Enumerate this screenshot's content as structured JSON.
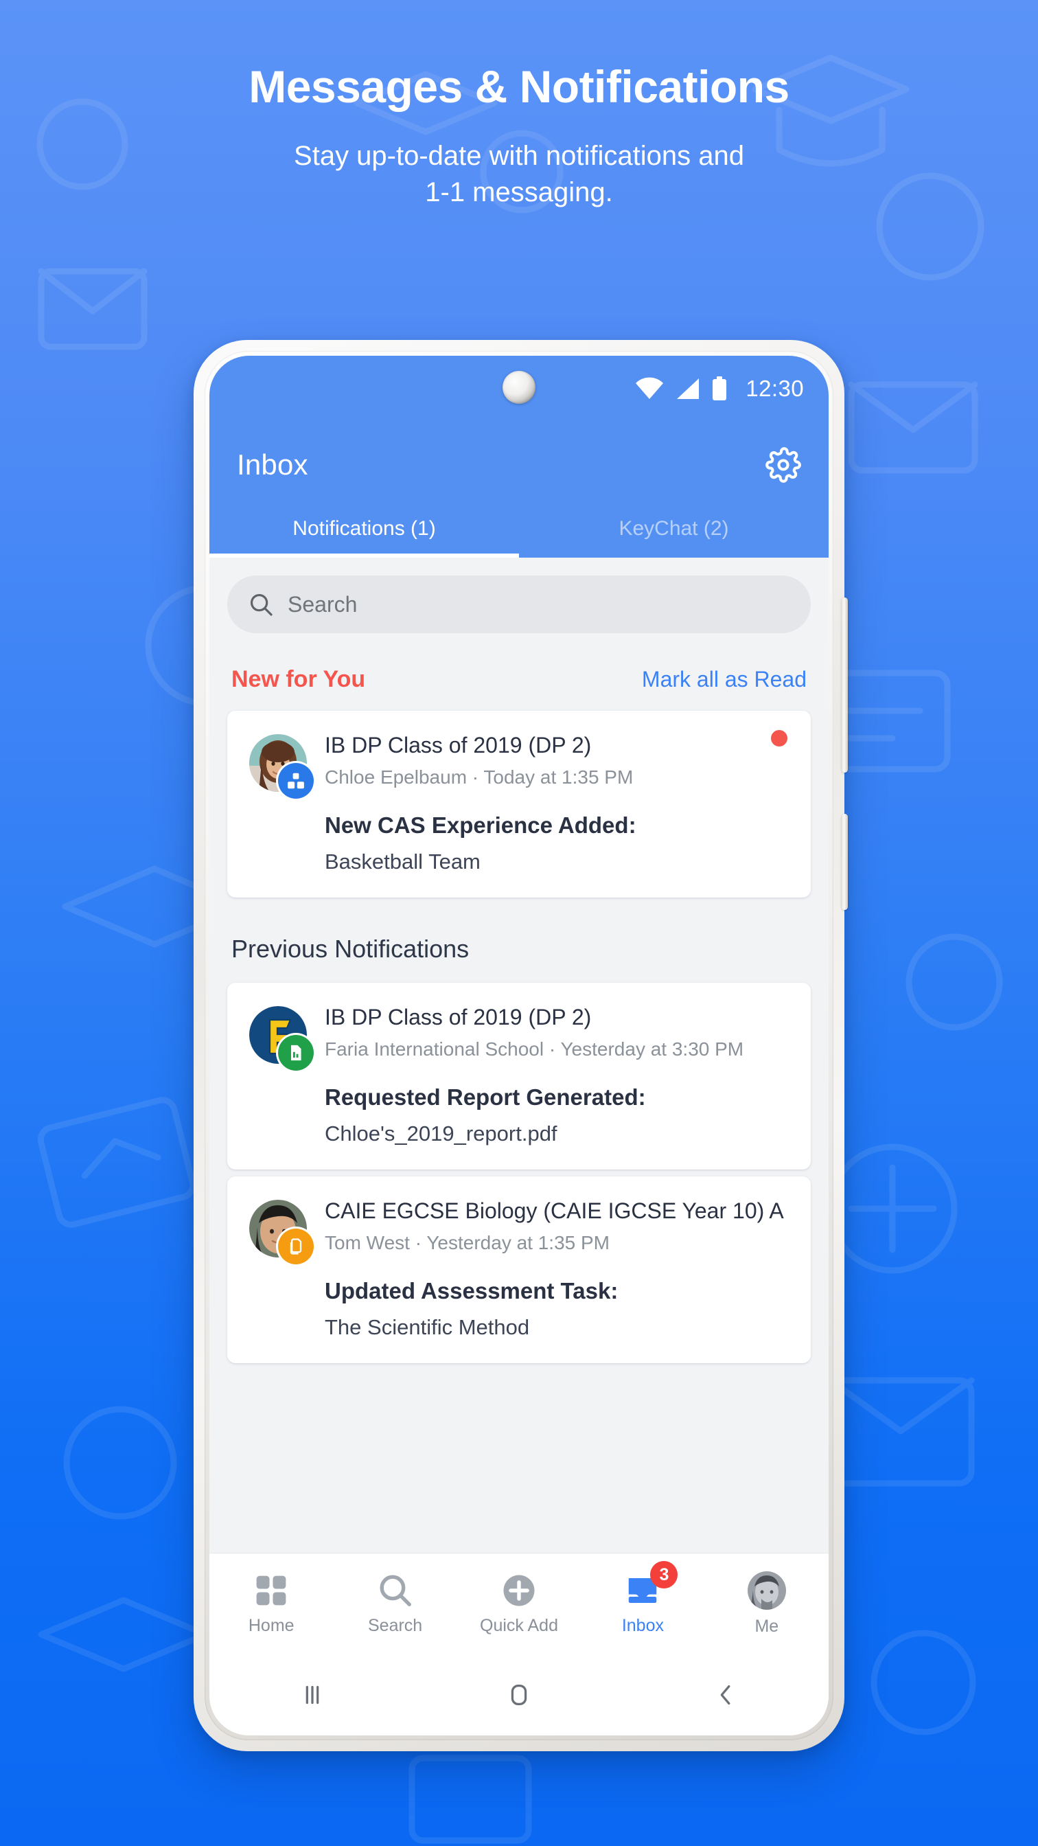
{
  "promo": {
    "title": "Messages & Notifications",
    "subtitle_line1": "Stay up-to-date with notifications and",
    "subtitle_line2": "1-1 messaging."
  },
  "colors": {
    "bg_top": "#5b93f7",
    "bg_bottom": "#0b68f2",
    "app_blue": "#5490f2",
    "accent_blue": "#3b82f6",
    "accent_red": "#f4564e",
    "badge_red": "#f4403b",
    "screen_bg": "#f1f3f5"
  },
  "status_bar": {
    "time": "12:30",
    "icons": [
      "wifi-icon",
      "cellular-signal-icon",
      "battery-icon"
    ]
  },
  "header": {
    "title": "Inbox",
    "settings_icon": "gear-icon"
  },
  "tabs": [
    {
      "label": "Notifications (1)",
      "active": true
    },
    {
      "label": "KeyChat (2)",
      "active": false
    }
  ],
  "search": {
    "placeholder": "Search",
    "value": "",
    "icon": "search-icon"
  },
  "sections": {
    "new_for_you": "New for You",
    "mark_all_as_read": "Mark all as Read",
    "previous_notifications": "Previous Notifications"
  },
  "notifications_new": [
    {
      "title": "IB DP Class of 2019 (DP 2)",
      "meta": "Chloe Epelbaum · Today at 1:35 PM",
      "action": "New CAS Experience Added:",
      "detail": "Basketball Team",
      "unread": true,
      "avatar": "photo-woman-avatar",
      "badge_icon": "cas-group-icon",
      "badge_color": "#2979e8"
    }
  ],
  "notifications_previous": [
    {
      "title": "IB DP Class of 2019 (DP 2)",
      "meta": "Faria International School · Yesterday at 3:30 PM",
      "action": "Requested Report Generated:",
      "detail": "Chloe's_2019_report.pdf",
      "unread": false,
      "avatar": "faria-logo-avatar",
      "badge_icon": "report-document-icon",
      "badge_color": "#21a04a"
    },
    {
      "title": "CAIE EGCSE Biology (CAIE IGCSE Year 10) A",
      "meta": "Tom West · Yesterday at 1:35 PM",
      "action": "Updated Assessment Task:",
      "detail": "The Scientific Method",
      "unread": false,
      "avatar": "photo-man-avatar",
      "badge_icon": "assessment-task-icon",
      "badge_color": "#f59c10"
    }
  ],
  "bottom_nav": [
    {
      "label": "Home",
      "icon": "grid-icon",
      "active": false,
      "badge": ""
    },
    {
      "label": "Search",
      "icon": "search-icon",
      "active": false,
      "badge": ""
    },
    {
      "label": "Quick Add",
      "icon": "plus-circle-icon",
      "active": false,
      "badge": ""
    },
    {
      "label": "Inbox",
      "icon": "inbox-icon",
      "active": true,
      "badge": "3"
    },
    {
      "label": "Me",
      "icon": "avatar-icon",
      "active": false,
      "badge": ""
    }
  ],
  "system_bar": [
    {
      "name": "recents-button",
      "icon": "three-bars-icon"
    },
    {
      "name": "home-button",
      "icon": "rounded-square-icon"
    },
    {
      "name": "back-button",
      "icon": "chevron-left-icon"
    }
  ]
}
